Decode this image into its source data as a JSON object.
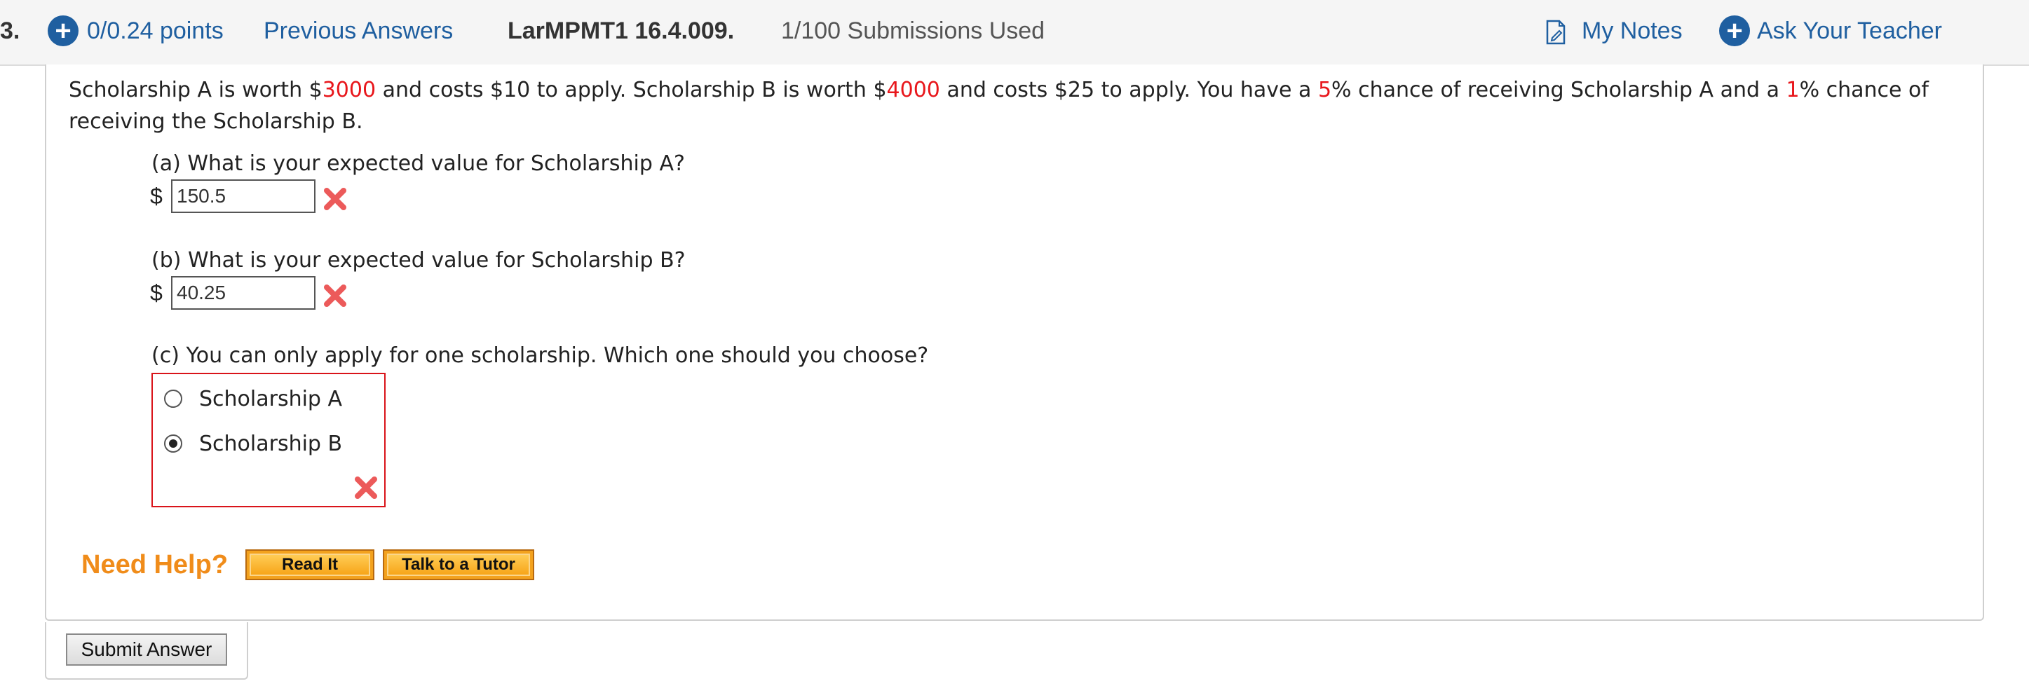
{
  "header": {
    "question_number": "3.",
    "points": "0/0.24 points",
    "previous_answers": "Previous Answers",
    "question_id": "LarMPMT1 16.4.009.",
    "submissions": "1/100 Submissions Used",
    "my_notes": "My Notes",
    "ask_teacher": "Ask Your Teacher",
    "icons": [
      "plus-circle-icon",
      "note-icon",
      "plus-circle-icon"
    ],
    "link_color": "#1f5fa0"
  },
  "question": {
    "stem_parts": [
      {
        "text": "Scholarship A is worth $"
      },
      {
        "text": "3000",
        "color": "#e8161b"
      },
      {
        "text": " and costs $10 to apply. Scholarship B is worth $"
      },
      {
        "text": "4000",
        "color": "#e8161b"
      },
      {
        "text": " and costs $25 to apply. You have a "
      },
      {
        "text": "5",
        "color": "#e8161b"
      },
      {
        "text": "% chance of receiving Scholarship A and a "
      },
      {
        "text": "1",
        "color": "#e8161b"
      },
      {
        "text": "% chance of receiving the Scholarship B."
      }
    ],
    "part_a": {
      "label": "(a) What is your expected value for Scholarship A?",
      "currency": "$",
      "value": "150.5",
      "status": "incorrect"
    },
    "part_b": {
      "label": "(b) What is your expected value for Scholarship B?",
      "currency": "$",
      "value": "40.25",
      "status": "incorrect"
    },
    "part_c": {
      "label": "(c) You can only apply for one scholarship. Which one should you choose?",
      "options": [
        {
          "label": "Scholarship A",
          "selected": false
        },
        {
          "label": "Scholarship B",
          "selected": true
        }
      ],
      "status": "incorrect"
    }
  },
  "help": {
    "title": "Need Help?",
    "read_it": "Read It",
    "talk_tutor": "Talk to a Tutor"
  },
  "submit": {
    "label": "Submit Answer"
  },
  "colors": {
    "accent_red": "#e8161b",
    "help_orange": "#f08c1a",
    "incorrect_x": "#ec5a5a"
  }
}
